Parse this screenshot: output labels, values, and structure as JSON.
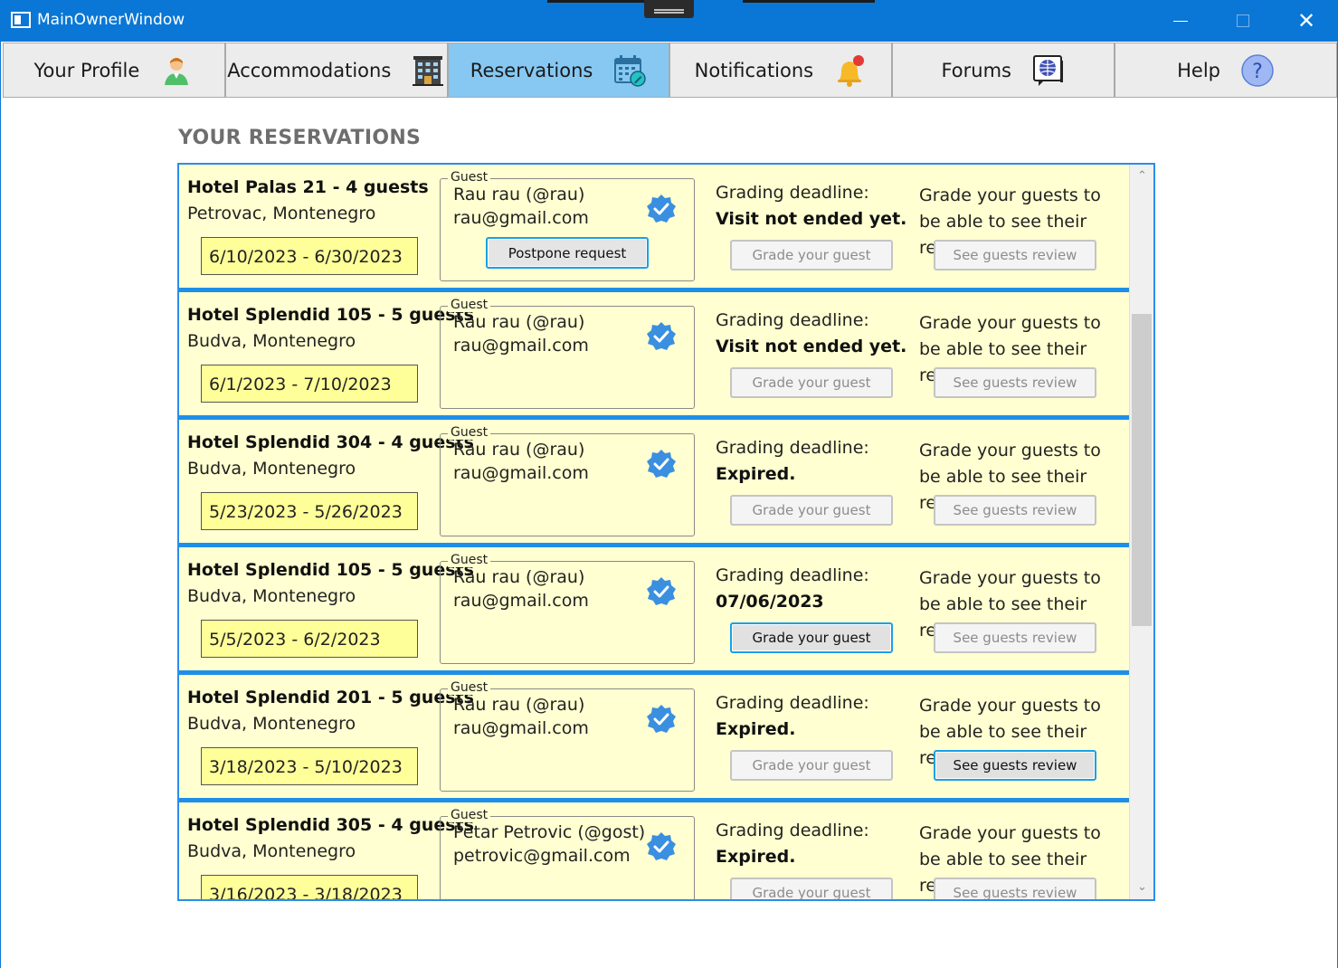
{
  "window": {
    "title": "MainOwnerWindow",
    "minimize": "—",
    "close": "✕"
  },
  "tabs": [
    {
      "label": "Your Profile",
      "icon": "person-icon"
    },
    {
      "label": "Accommodations",
      "icon": "building-icon"
    },
    {
      "label": "Reservations",
      "icon": "calendar-icon",
      "active": true
    },
    {
      "label": "Notifications",
      "icon": "bell-icon"
    },
    {
      "label": "Forums",
      "icon": "forum-icon"
    },
    {
      "label": "Help",
      "icon": "help-icon",
      "glyph": "?"
    }
  ],
  "page_title": "YOUR RESERVATIONS",
  "labels": {
    "guest_legend": "Guest",
    "deadline_label": "Grading deadline:",
    "review_text": "Grade your guests to be able to see their review",
    "grade_button": "Grade your guest",
    "see_button": "See guests review",
    "postpone_button": "Postpone request"
  },
  "scroll": {
    "up": "⌃",
    "down": "⌄"
  },
  "reservations": [
    {
      "title": "Hotel Palas 21 - 4 guests",
      "location": "Petrovac, Montenegro",
      "dates": "6/10/2023 - 6/30/2023",
      "guest_name": "Rau rau (@rau)",
      "guest_email": "rau@gmail.com",
      "deadline": "Visit not ended yet.",
      "postpone": true,
      "grade_enabled": false,
      "see_enabled": false
    },
    {
      "title": "Hotel Splendid 105 - 5 guests",
      "location": "Budva, Montenegro",
      "dates": "6/1/2023 - 7/10/2023",
      "guest_name": "Rau rau (@rau)",
      "guest_email": "rau@gmail.com",
      "deadline": "Visit not ended yet.",
      "postpone": false,
      "grade_enabled": false,
      "see_enabled": false
    },
    {
      "title": "Hotel Splendid 304 - 4 guests",
      "location": "Budva, Montenegro",
      "dates": "5/23/2023 - 5/26/2023",
      "guest_name": "Rau rau (@rau)",
      "guest_email": "rau@gmail.com",
      "deadline": "Expired.",
      "postpone": false,
      "grade_enabled": false,
      "see_enabled": false
    },
    {
      "title": "Hotel Splendid 105 - 5 guests",
      "location": "Budva, Montenegro",
      "dates": "5/5/2023 - 6/2/2023",
      "guest_name": "Rau rau (@rau)",
      "guest_email": "rau@gmail.com",
      "deadline": "07/06/2023",
      "postpone": false,
      "grade_enabled": true,
      "see_enabled": false
    },
    {
      "title": "Hotel Splendid 201 - 5 guests",
      "location": "Budva, Montenegro",
      "dates": "3/18/2023 - 5/10/2023",
      "guest_name": "Rau rau (@rau)",
      "guest_email": "rau@gmail.com",
      "deadline": "Expired.",
      "postpone": false,
      "grade_enabled": false,
      "see_enabled": true
    },
    {
      "title": "Hotel Splendid 305 - 4 guests",
      "location": "Budva, Montenegro",
      "dates": "3/16/2023 - 3/18/2023",
      "guest_name": "Petar Petrovic (@gost)",
      "guest_email": "petrovic@gmail.com",
      "deadline": "Expired.",
      "postpone": false,
      "grade_enabled": false,
      "see_enabled": false
    }
  ],
  "colors": {
    "titlebar": "#0a77d6",
    "active_tab": "#87c8f2",
    "card_bg": "#ffffd1",
    "date_bg": "#ffff99",
    "accent": "#1e8fe8"
  }
}
